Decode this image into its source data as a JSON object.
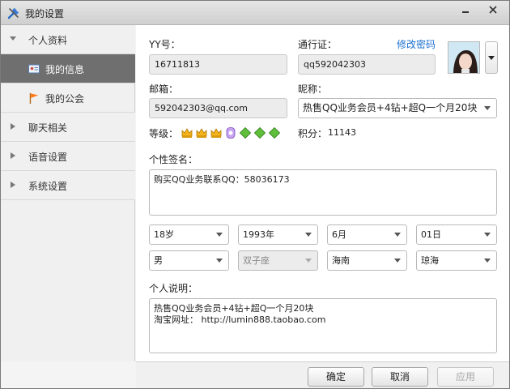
{
  "window": {
    "title": "我的设置"
  },
  "sidebar": {
    "groups": [
      {
        "label": "个人资料",
        "expanded": true
      },
      {
        "label": "聊天相关",
        "expanded": false
      },
      {
        "label": "语音设置",
        "expanded": false
      },
      {
        "label": "系统设置",
        "expanded": false
      }
    ],
    "subitems": [
      {
        "label": "我的信息",
        "icon": "id-card-icon",
        "active": true
      },
      {
        "label": "我的公会",
        "icon": "flag-icon",
        "active": false
      }
    ]
  },
  "profile": {
    "yy_label": "YY号：",
    "yy_value": "16711813",
    "passport_label": "通行证：",
    "passport_value": "qq592042303",
    "change_password": "修改密码",
    "email_label": "邮箱：",
    "email_value": "592042303@qq.com",
    "nickname_label": "昵称：",
    "nickname_value": "热售QQ业务会员+4钻+超Q一个月20块",
    "level_label": "等级：",
    "level_badges": [
      "crown-icon",
      "crown-icon",
      "crown-icon",
      "moon-icon",
      "diamond-icon",
      "diamond-icon",
      "diamond-icon"
    ],
    "points_label": "积分：",
    "points_value": "11143",
    "signature_label": "个性签名：",
    "signature_value": "购买QQ业务联系QQ：58036173",
    "age": "18岁",
    "year": "1993年",
    "month": "6月",
    "day": "01日",
    "gender": "男",
    "zodiac": "双子座",
    "province": "海南",
    "city": "琼海",
    "bio_label": "个人说明：",
    "bio_value": "热售QQ业务会员+4钻+超Q一个月20块\n淘宝网址： http://lumin888.taobao.com"
  },
  "footer": {
    "ok": "确定",
    "cancel": "取消",
    "apply": "应用"
  },
  "colors": {
    "accent_link": "#1a6fd0",
    "active_nav_bg": "#6f6f6f"
  }
}
